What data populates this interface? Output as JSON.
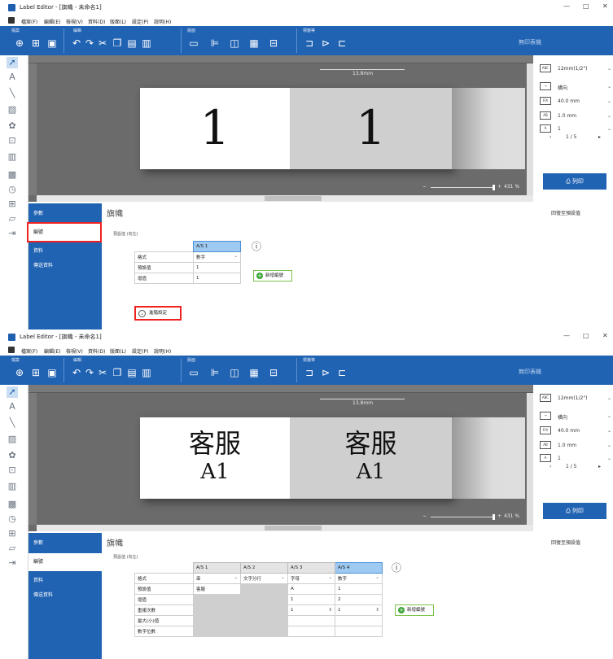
{
  "app": {
    "title_top": "Label Editor - [旗幟 - 未命名1]",
    "title_bottom": "Label Editor - [旗幟 - 未命名1]",
    "window_controls": [
      "—",
      "□",
      "✕"
    ]
  },
  "menu": [
    "檔案(F)",
    "編輯(E)",
    "檢視(V)",
    "資料(D)",
    "版面(L)",
    "設定(P)",
    "說明(H)"
  ],
  "ribbon": {
    "groups": [
      "檔案",
      "編輯",
      "版面",
      "標籤等"
    ],
    "right_label": "無印表機",
    "icons": [
      "new-icon",
      "new-from-template-icon",
      "save-icon",
      "undo-icon",
      "redo-icon",
      "cut-icon",
      "copy-icon",
      "paste-icon",
      "delete-icon",
      "align-icon",
      "distribute-icon",
      "arrange-icon",
      "group-icon",
      "order-icon",
      "flip-icon",
      "rotate-icon",
      "size-icon"
    ]
  },
  "tools": [
    "select-arrow-icon",
    "text-tool-icon",
    "line-tool-icon",
    "image-tool-icon",
    "clipart-icon",
    "shape-icon",
    "barcode-icon",
    "qrcode-icon",
    "datetime-icon",
    "table-icon",
    "frame-icon",
    "insert-icon"
  ],
  "canvas": {
    "dimension": "13.8mm",
    "zoom": "431 %",
    "zoom_minus": "−",
    "zoom_plus": "+"
  },
  "label_top": {
    "cell1": "1",
    "cell2": "1"
  },
  "label_bottom": {
    "cell1_line1": "客服",
    "cell1_line2": "A1",
    "cell2_line1": "客服",
    "cell2_line2": "A1"
  },
  "properties": {
    "tape": "12mm(1/2\")",
    "orientation": "橫向",
    "length": "40.0 mm",
    "margin": "1.0 mm",
    "copies": "1",
    "page": "1 / 5",
    "print_label": "列印"
  },
  "bottom_nav": [
    "參數",
    "編號",
    "資料",
    "傳送資料"
  ],
  "panel": {
    "title": "旗幟",
    "reset_label": "回復至預設值",
    "subtitle_top": "預設值 (向左)",
    "subtitle_bottom": "預設值 (向左)",
    "add_serial_label": "新增編號",
    "advanced_label": "進階設定"
  },
  "table_top": {
    "columns": [
      "A/S 1"
    ],
    "rows": [
      {
        "label": "格式",
        "values": [
          "數字"
        ]
      },
      {
        "label": "預設值",
        "values": [
          "1"
        ]
      },
      {
        "label": "增值",
        "values": [
          "1"
        ]
      }
    ]
  },
  "table_bottom": {
    "columns": [
      "A/S 1",
      "A/S 2",
      "A/S 3",
      "A/S 4"
    ],
    "rows": [
      {
        "label": "格式",
        "values": [
          "串",
          "文字分行",
          "字母",
          "數字"
        ]
      },
      {
        "label": "預設值",
        "values": [
          "客服",
          "",
          "A",
          "1"
        ]
      },
      {
        "label": "增值",
        "values": [
          "",
          "",
          "1",
          "2"
        ]
      },
      {
        "label": "重複次數",
        "values": [
          "",
          "",
          "1",
          "1"
        ]
      },
      {
        "label": "最大(小)值",
        "values": [
          "",
          "",
          "",
          ""
        ]
      },
      {
        "label": "數字位數",
        "values": [
          "",
          "",
          "",
          ""
        ]
      }
    ]
  }
}
